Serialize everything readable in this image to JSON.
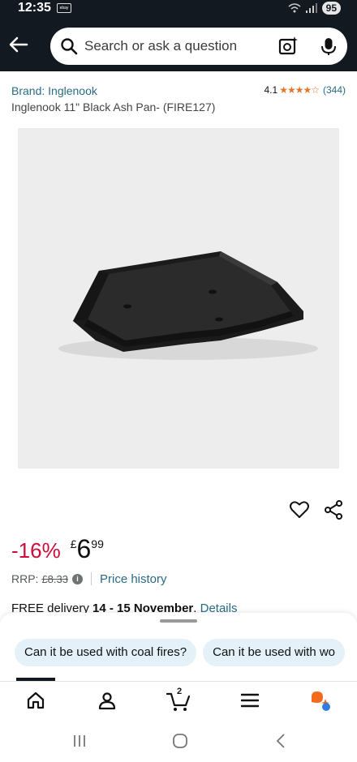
{
  "status_bar": {
    "time": "12:35",
    "app_icon_text": "ebay",
    "battery": "95"
  },
  "search": {
    "placeholder": "Search or ask a question"
  },
  "product": {
    "brand": "Brand: Inglenook",
    "title": "Inglenook 11\" Black Ash Pan- (FIRE127)",
    "rating_value": "4.1",
    "stars": "★★★★☆",
    "rating_count": "(344)"
  },
  "price": {
    "discount": "-16%",
    "currency": "£",
    "whole": "6",
    "fraction": "99",
    "rrp_label": "RRP:",
    "rrp_value": "£8.33",
    "price_history": "Price history"
  },
  "delivery": {
    "prefix": "FREE delivery ",
    "dates": "14 - 15 November",
    "suffix": ". ",
    "details_link": "Details"
  },
  "suggestions": [
    "Can it be used with coal fires?",
    "Can it be used with wo"
  ],
  "colors": {
    "header_bg": "#131921",
    "discount": "#cc0c39",
    "link": "#2a6a86",
    "star": "#e0782a",
    "chip_bg": "#e4f1f8"
  }
}
